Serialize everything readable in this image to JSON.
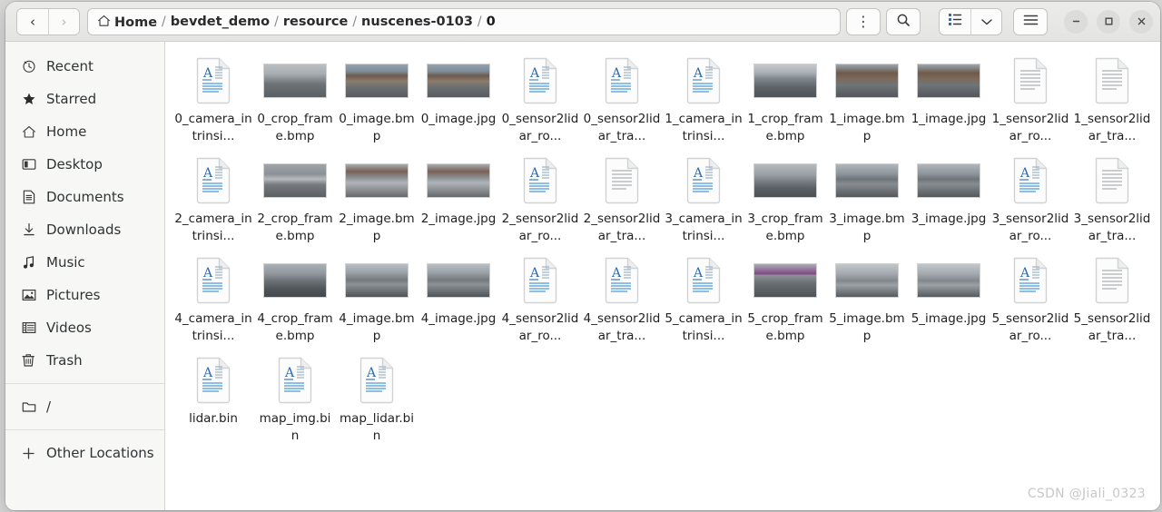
{
  "window": {
    "title": "0",
    "nav": {
      "back_label": "‹",
      "forward_label": "›"
    },
    "controls": {
      "minimize_label": "–",
      "maximize_label": "□",
      "close_label": "✕"
    }
  },
  "breadcrumb": {
    "separator": "/",
    "items": [
      {
        "label": "Home",
        "icon": "home-icon",
        "current": false
      },
      {
        "label": "bevdet_demo",
        "current": false
      },
      {
        "label": "resource",
        "current": false
      },
      {
        "label": "nuscenes-0103",
        "current": false
      },
      {
        "label": "0",
        "current": true
      }
    ]
  },
  "toolbar": {
    "menu_label": "⋮",
    "search_label": "search-icon",
    "view_list_label": "list-view-icon",
    "view_dropdown_label": "⌄",
    "hamburger_label": "menu-icon"
  },
  "sidebar": {
    "groups": [
      {
        "items": [
          {
            "label": "Recent",
            "icon": "clock-icon"
          },
          {
            "label": "Starred",
            "icon": "star-icon"
          },
          {
            "label": "Home",
            "icon": "home-icon"
          },
          {
            "label": "Desktop",
            "icon": "desktop-icon"
          },
          {
            "label": "Documents",
            "icon": "document-icon"
          },
          {
            "label": "Downloads",
            "icon": "download-icon"
          },
          {
            "label": "Music",
            "icon": "music-icon"
          },
          {
            "label": "Pictures",
            "icon": "picture-icon"
          },
          {
            "label": "Videos",
            "icon": "video-icon"
          },
          {
            "label": "Trash",
            "icon": "trash-icon"
          }
        ]
      },
      {
        "items": [
          {
            "label": "/",
            "icon": "folder-icon"
          }
        ]
      },
      {
        "items": [
          {
            "label": "Other Locations",
            "icon": "plus-icon"
          }
        ]
      }
    ]
  },
  "files": [
    {
      "name": "0_camera_intrinsi...",
      "icon": "text-document-icon"
    },
    {
      "name": "0_crop_frame.bmp",
      "icon": "image-thumbnail",
      "thumb": "road-gray"
    },
    {
      "name": "0_image.bmp",
      "icon": "image-thumbnail",
      "thumb": "street-building"
    },
    {
      "name": "0_image.jpg",
      "icon": "image-thumbnail",
      "thumb": "street-building"
    },
    {
      "name": "0_sensor2lidar_ro...",
      "icon": "text-document-icon"
    },
    {
      "name": "0_sensor2lidar_tra...",
      "icon": "text-document-icon"
    },
    {
      "name": "1_camera_intrinsi...",
      "icon": "text-document-icon"
    },
    {
      "name": "1_crop_frame.bmp",
      "icon": "image-thumbnail",
      "thumb": "road-blue-line"
    },
    {
      "name": "1_image.bmp",
      "icon": "image-thumbnail",
      "thumb": "city-street"
    },
    {
      "name": "1_image.jpg",
      "icon": "image-thumbnail",
      "thumb": "city-street"
    },
    {
      "name": "1_sensor2lidar_ro...",
      "icon": "plain-document-icon"
    },
    {
      "name": "1_sensor2lidar_tra...",
      "icon": "plain-document-icon"
    },
    {
      "name": "2_camera_intrinsi...",
      "icon": "text-document-icon"
    },
    {
      "name": "2_crop_frame.bmp",
      "icon": "image-thumbnail",
      "thumb": "rail-gray"
    },
    {
      "name": "2_image.bmp",
      "icon": "image-thumbnail",
      "thumb": "rail-building"
    },
    {
      "name": "2_image.jpg",
      "icon": "image-thumbnail",
      "thumb": "rail-building"
    },
    {
      "name": "2_sensor2lidar_ro...",
      "icon": "text-document-icon"
    },
    {
      "name": "2_sensor2lidar_tra...",
      "icon": "plain-document-icon"
    },
    {
      "name": "3_camera_intrinsi...",
      "icon": "text-document-icon"
    },
    {
      "name": "3_crop_frame.bmp",
      "icon": "image-thumbnail",
      "thumb": "road-horizon"
    },
    {
      "name": "3_image.bmp",
      "icon": "image-thumbnail",
      "thumb": "skyline-road"
    },
    {
      "name": "3_image.jpg",
      "icon": "image-thumbnail",
      "thumb": "skyline-road"
    },
    {
      "name": "3_sensor2lidar_ro...",
      "icon": "text-document-icon"
    },
    {
      "name": "3_sensor2lidar_tra...",
      "icon": "plain-document-icon"
    },
    {
      "name": "4_camera_intrinsi...",
      "icon": "text-document-icon"
    },
    {
      "name": "4_crop_frame.bmp",
      "icon": "image-thumbnail",
      "thumb": "highway"
    },
    {
      "name": "4_image.bmp",
      "icon": "image-thumbnail",
      "thumb": "highway-city"
    },
    {
      "name": "4_image.jpg",
      "icon": "image-thumbnail",
      "thumb": "highway-city"
    },
    {
      "name": "4_sensor2lidar_ro...",
      "icon": "text-document-icon"
    },
    {
      "name": "4_sensor2lidar_tra...",
      "icon": "text-document-icon"
    },
    {
      "name": "5_camera_intrinsi...",
      "icon": "text-document-icon"
    },
    {
      "name": "5_crop_frame.bmp",
      "icon": "image-thumbnail",
      "thumb": "guardrail"
    },
    {
      "name": "5_image.bmp",
      "icon": "image-thumbnail",
      "thumb": "guardrail-sky"
    },
    {
      "name": "5_image.jpg",
      "icon": "image-thumbnail",
      "thumb": "guardrail-sky"
    },
    {
      "name": "5_sensor2lidar_ro...",
      "icon": "text-document-icon"
    },
    {
      "name": "5_sensor2lidar_tra...",
      "icon": "plain-document-icon"
    },
    {
      "name": "lidar.bin",
      "icon": "text-document-icon"
    },
    {
      "name": "map_img.bin",
      "icon": "text-document-icon"
    },
    {
      "name": "map_lidar.bin",
      "icon": "text-document-icon"
    }
  ],
  "watermark": {
    "text": "CSDN @Jiali_0323"
  },
  "colors": {
    "accent_blue": "#2a6fb8",
    "header_bg": "#e8e8e6",
    "sidebar_bg": "#f7f7f6",
    "text": "#2e3436"
  }
}
